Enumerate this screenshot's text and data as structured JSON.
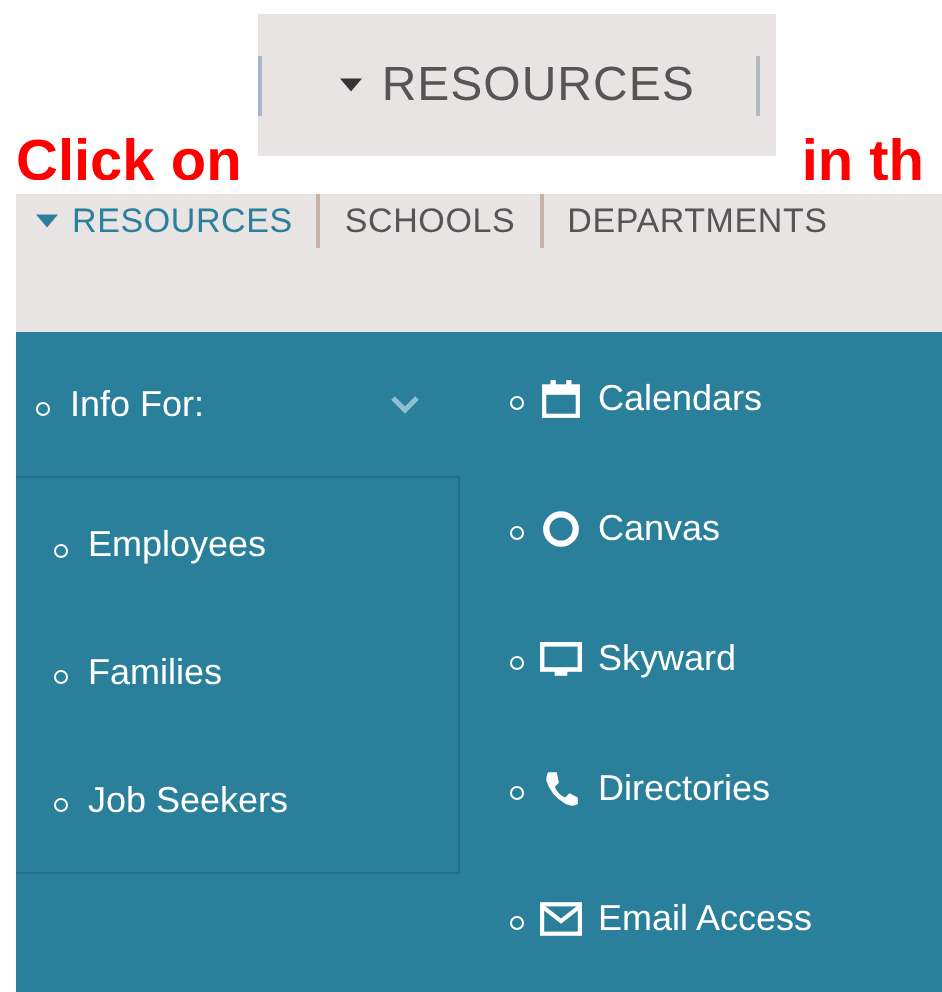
{
  "instruction": {
    "before": "Click on",
    "after": "in th"
  },
  "button_preview": {
    "label": "RESOURCES"
  },
  "nav": [
    {
      "label": "RESOURCES",
      "selected": true,
      "expanded": true
    },
    {
      "label": "SCHOOLS",
      "selected": false,
      "expanded": false
    },
    {
      "label": "DEPARTMENTS",
      "selected": false,
      "expanded": false
    }
  ],
  "menu": {
    "group": {
      "label": "Info For:",
      "expanded": true,
      "items": [
        {
          "label": "Employees"
        },
        {
          "label": "Families"
        },
        {
          "label": "Job Seekers"
        }
      ]
    },
    "links": [
      {
        "label": "Calendars",
        "kind": "calendar"
      },
      {
        "label": "Canvas",
        "kind": "circle"
      },
      {
        "label": "Skyward",
        "kind": "monitor"
      },
      {
        "label": "Directories",
        "kind": "phone"
      },
      {
        "label": "Email Access",
        "kind": "envelope"
      }
    ]
  }
}
